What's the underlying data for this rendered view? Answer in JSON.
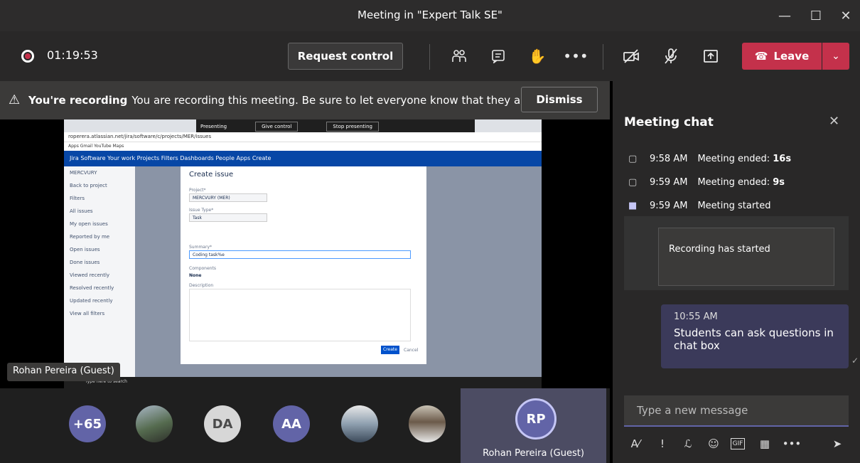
{
  "window": {
    "title": "Meeting in \"Expert Talk SE\""
  },
  "controls": {
    "timer": "01:19:53",
    "request_control": "Request control",
    "leave": "Leave"
  },
  "banner": {
    "bold": "You're recording",
    "text": "You are recording this meeting. Be sure to let everyone know that they are...",
    "dismiss": "Dismiss"
  },
  "shared_screen": {
    "presenting": "Presenting",
    "give_control": "Give control",
    "stop_presenting": "Stop presenting",
    "address": "roperera.atlassian.net/jira/software/c/projects/MER/issues",
    "bookmarks": "Apps   Gmail   YouTube   Maps",
    "jira_nav": "Jira Software   Your work   Projects   Filters   Dashboards   People   Apps   Create",
    "sidebar": [
      "MERCVURY",
      "Back to project",
      "Filters",
      "All issues",
      "My open issues",
      "Reported by me",
      "Open issues",
      "Done issues",
      "Viewed recently",
      "Resolved recently",
      "Updated recently",
      "View all filters"
    ],
    "modal": {
      "title": "Create issue",
      "project_label": "Project*",
      "project": "MERCVURY (MER)",
      "type_label": "Issue Type*",
      "type": "Task",
      "summary_label": "Summary*",
      "summary": "Coding task%e",
      "components_label": "Components",
      "components": "None",
      "description_label": "Description",
      "create": "Create",
      "cancel": "Cancel"
    },
    "taskbar": "Type here to search"
  },
  "presenter_chip": "Rohan Pereira (Guest)",
  "participants": {
    "more": "+65",
    "initials": [
      "DA",
      "AA"
    ],
    "speaker_initials": "RP",
    "speaker_name": "Rohan Pereira (Guest)"
  },
  "chat": {
    "title": "Meeting chat",
    "events": [
      {
        "time": "9:58 AM",
        "text": "Meeting ended: ",
        "bold": "16s"
      },
      {
        "time": "9:59 AM",
        "text": "Meeting ended: ",
        "bold": "9s"
      },
      {
        "time": "9:59 AM",
        "text": "Meeting started",
        "bold": ""
      }
    ],
    "recording": "Recording has started",
    "message": {
      "time": "10:55 AM",
      "text": "Students can ask questions in chat box"
    },
    "compose_placeholder": "Type a new message"
  },
  "colors": {
    "leave": "#c4314b",
    "accent": "#6264a7",
    "jira": "#0747a6"
  }
}
